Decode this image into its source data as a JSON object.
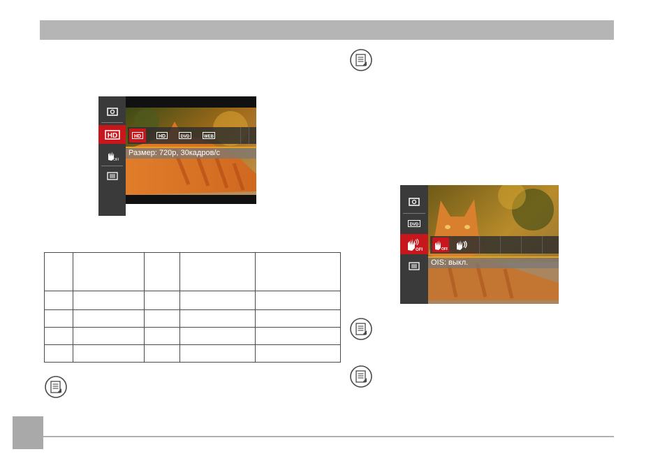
{
  "screen1": {
    "menu_icons": [
      "exposure-icon",
      "hd-video-icon",
      "stabilizer-off-icon",
      "list-menu-icon"
    ],
    "options": [
      "HD",
      "HD",
      "DVD",
      "WEB"
    ],
    "hint": "Размер: 720р, 30кадров/с"
  },
  "screen2": {
    "menu_icons": [
      "exposure-icon",
      "dvd-icon",
      "stabilizer-off-icon",
      "list-menu-icon"
    ],
    "options": [
      "stabilizer-off-icon",
      "stabilizer-on-icon"
    ],
    "hint": "OIS: выкл."
  },
  "table": {
    "rows": 5,
    "cols": 5
  },
  "note_icons": [
    "note-icon",
    "note-icon",
    "note-icon",
    "note-icon"
  ],
  "colors": {
    "accent_red": "#c8161d",
    "accent_orange": "#e8a020",
    "header_gray": "#b5b5b5"
  }
}
